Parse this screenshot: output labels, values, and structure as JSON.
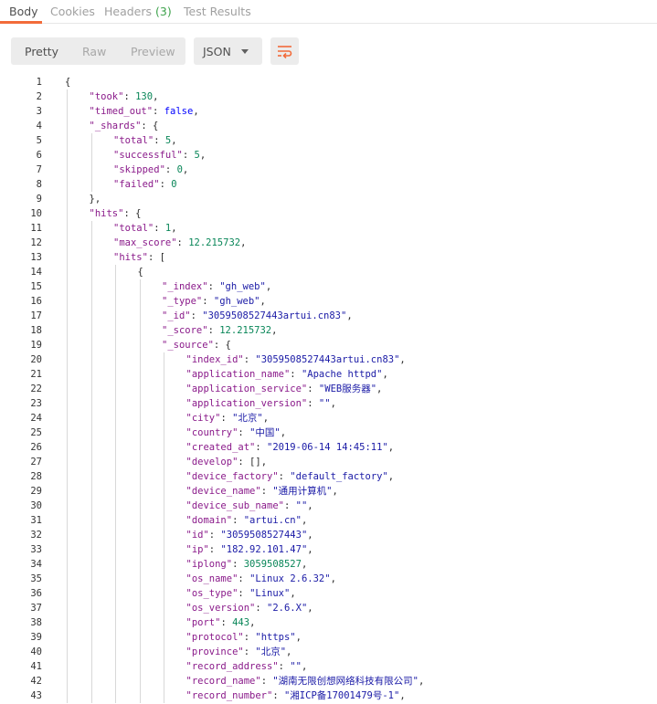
{
  "tabs": [
    {
      "label": "Body",
      "count": "",
      "active": true
    },
    {
      "label": "Cookies",
      "count": "",
      "active": false
    },
    {
      "label": "Headers",
      "count": "(3)",
      "active": false
    },
    {
      "label": "Test Results",
      "count": "",
      "active": false
    }
  ],
  "view_modes": [
    {
      "label": "Pretty",
      "active": true
    },
    {
      "label": "Raw",
      "active": false
    },
    {
      "label": "Preview",
      "active": false
    }
  ],
  "format": {
    "selected": "JSON"
  },
  "icons": {
    "wrap": "wrap-lines-icon",
    "dropdown": "chevron-down-icon"
  },
  "colors": {
    "accent": "#f26b3a",
    "key": "#8a1a8a",
    "string": "#1a1aa6",
    "number": "#098658",
    "boolean": "#0000ff"
  },
  "lines": [
    {
      "n": "1",
      "d": 0,
      "t": [
        [
          "p",
          "{"
        ]
      ]
    },
    {
      "n": "2",
      "d": 1,
      "t": [
        [
          "k",
          "\"took\""
        ],
        [
          "p",
          ": "
        ],
        [
          "n",
          "130"
        ],
        [
          "p",
          ","
        ]
      ]
    },
    {
      "n": "3",
      "d": 1,
      "t": [
        [
          "k",
          "\"timed_out\""
        ],
        [
          "p",
          ": "
        ],
        [
          "b",
          "false"
        ],
        [
          "p",
          ","
        ]
      ]
    },
    {
      "n": "4",
      "d": 1,
      "t": [
        [
          "k",
          "\"_shards\""
        ],
        [
          "p",
          ": {"
        ]
      ]
    },
    {
      "n": "5",
      "d": 2,
      "t": [
        [
          "k",
          "\"total\""
        ],
        [
          "p",
          ": "
        ],
        [
          "n",
          "5"
        ],
        [
          "p",
          ","
        ]
      ]
    },
    {
      "n": "6",
      "d": 2,
      "t": [
        [
          "k",
          "\"successful\""
        ],
        [
          "p",
          ": "
        ],
        [
          "n",
          "5"
        ],
        [
          "p",
          ","
        ]
      ]
    },
    {
      "n": "7",
      "d": 2,
      "t": [
        [
          "k",
          "\"skipped\""
        ],
        [
          "p",
          ": "
        ],
        [
          "n",
          "0"
        ],
        [
          "p",
          ","
        ]
      ]
    },
    {
      "n": "8",
      "d": 2,
      "t": [
        [
          "k",
          "\"failed\""
        ],
        [
          "p",
          ": "
        ],
        [
          "n",
          "0"
        ]
      ]
    },
    {
      "n": "9",
      "d": 1,
      "t": [
        [
          "p",
          "},"
        ]
      ]
    },
    {
      "n": "10",
      "d": 1,
      "t": [
        [
          "k",
          "\"hits\""
        ],
        [
          "p",
          ": {"
        ]
      ]
    },
    {
      "n": "11",
      "d": 2,
      "t": [
        [
          "k",
          "\"total\""
        ],
        [
          "p",
          ": "
        ],
        [
          "n",
          "1"
        ],
        [
          "p",
          ","
        ]
      ]
    },
    {
      "n": "12",
      "d": 2,
      "t": [
        [
          "k",
          "\"max_score\""
        ],
        [
          "p",
          ": "
        ],
        [
          "n",
          "12.215732"
        ],
        [
          "p",
          ","
        ]
      ]
    },
    {
      "n": "13",
      "d": 2,
      "t": [
        [
          "k",
          "\"hits\""
        ],
        [
          "p",
          ": ["
        ]
      ]
    },
    {
      "n": "14",
      "d": 3,
      "t": [
        [
          "p",
          "{"
        ]
      ]
    },
    {
      "n": "15",
      "d": 4,
      "t": [
        [
          "k",
          "\"_index\""
        ],
        [
          "p",
          ": "
        ],
        [
          "s",
          "\"gh_web\""
        ],
        [
          "p",
          ","
        ]
      ]
    },
    {
      "n": "16",
      "d": 4,
      "t": [
        [
          "k",
          "\"_type\""
        ],
        [
          "p",
          ": "
        ],
        [
          "s",
          "\"gh_web\""
        ],
        [
          "p",
          ","
        ]
      ]
    },
    {
      "n": "17",
      "d": 4,
      "t": [
        [
          "k",
          "\"_id\""
        ],
        [
          "p",
          ": "
        ],
        [
          "s",
          "\"3059508527443artui.cn83\""
        ],
        [
          "p",
          ","
        ]
      ]
    },
    {
      "n": "18",
      "d": 4,
      "t": [
        [
          "k",
          "\"_score\""
        ],
        [
          "p",
          ": "
        ],
        [
          "n",
          "12.215732"
        ],
        [
          "p",
          ","
        ]
      ]
    },
    {
      "n": "19",
      "d": 4,
      "t": [
        [
          "k",
          "\"_source\""
        ],
        [
          "p",
          ": {"
        ]
      ]
    },
    {
      "n": "20",
      "d": 5,
      "t": [
        [
          "k",
          "\"index_id\""
        ],
        [
          "p",
          ": "
        ],
        [
          "s",
          "\"3059508527443artui.cn83\""
        ],
        [
          "p",
          ","
        ]
      ]
    },
    {
      "n": "21",
      "d": 5,
      "t": [
        [
          "k",
          "\"application_name\""
        ],
        [
          "p",
          ": "
        ],
        [
          "s",
          "\"Apache httpd\""
        ],
        [
          "p",
          ","
        ]
      ]
    },
    {
      "n": "22",
      "d": 5,
      "t": [
        [
          "k",
          "\"application_service\""
        ],
        [
          "p",
          ": "
        ],
        [
          "s",
          "\"WEB服务器\""
        ],
        [
          "p",
          ","
        ]
      ]
    },
    {
      "n": "23",
      "d": 5,
      "t": [
        [
          "k",
          "\"application_version\""
        ],
        [
          "p",
          ": "
        ],
        [
          "s",
          "\"\""
        ],
        [
          "p",
          ","
        ]
      ]
    },
    {
      "n": "24",
      "d": 5,
      "t": [
        [
          "k",
          "\"city\""
        ],
        [
          "p",
          ": "
        ],
        [
          "s",
          "\"北京\""
        ],
        [
          "p",
          ","
        ]
      ]
    },
    {
      "n": "25",
      "d": 5,
      "t": [
        [
          "k",
          "\"country\""
        ],
        [
          "p",
          ": "
        ],
        [
          "s",
          "\"中国\""
        ],
        [
          "p",
          ","
        ]
      ]
    },
    {
      "n": "26",
      "d": 5,
      "t": [
        [
          "k",
          "\"created_at\""
        ],
        [
          "p",
          ": "
        ],
        [
          "s",
          "\"2019-06-14 14:45:11\""
        ],
        [
          "p",
          ","
        ]
      ]
    },
    {
      "n": "27",
      "d": 5,
      "t": [
        [
          "k",
          "\"develop\""
        ],
        [
          "p",
          ": [],"
        ]
      ]
    },
    {
      "n": "28",
      "d": 5,
      "t": [
        [
          "k",
          "\"device_factory\""
        ],
        [
          "p",
          ": "
        ],
        [
          "s",
          "\"default_factory\""
        ],
        [
          "p",
          ","
        ]
      ]
    },
    {
      "n": "29",
      "d": 5,
      "t": [
        [
          "k",
          "\"device_name\""
        ],
        [
          "p",
          ": "
        ],
        [
          "s",
          "\"通用计算机\""
        ],
        [
          "p",
          ","
        ]
      ]
    },
    {
      "n": "30",
      "d": 5,
      "t": [
        [
          "k",
          "\"device_sub_name\""
        ],
        [
          "p",
          ": "
        ],
        [
          "s",
          "\"\""
        ],
        [
          "p",
          ","
        ]
      ]
    },
    {
      "n": "31",
      "d": 5,
      "t": [
        [
          "k",
          "\"domain\""
        ],
        [
          "p",
          ": "
        ],
        [
          "s",
          "\"artui.cn\""
        ],
        [
          "p",
          ","
        ]
      ]
    },
    {
      "n": "32",
      "d": 5,
      "t": [
        [
          "k",
          "\"id\""
        ],
        [
          "p",
          ": "
        ],
        [
          "s",
          "\"3059508527443\""
        ],
        [
          "p",
          ","
        ]
      ]
    },
    {
      "n": "33",
      "d": 5,
      "t": [
        [
          "k",
          "\"ip\""
        ],
        [
          "p",
          ": "
        ],
        [
          "s",
          "\"182.92.101.47\""
        ],
        [
          "p",
          ","
        ]
      ]
    },
    {
      "n": "34",
      "d": 5,
      "t": [
        [
          "k",
          "\"iplong\""
        ],
        [
          "p",
          ": "
        ],
        [
          "n",
          "3059508527"
        ],
        [
          "p",
          ","
        ]
      ]
    },
    {
      "n": "35",
      "d": 5,
      "t": [
        [
          "k",
          "\"os_name\""
        ],
        [
          "p",
          ": "
        ],
        [
          "s",
          "\"Linux 2.6.32\""
        ],
        [
          "p",
          ","
        ]
      ]
    },
    {
      "n": "36",
      "d": 5,
      "t": [
        [
          "k",
          "\"os_type\""
        ],
        [
          "p",
          ": "
        ],
        [
          "s",
          "\"Linux\""
        ],
        [
          "p",
          ","
        ]
      ]
    },
    {
      "n": "37",
      "d": 5,
      "t": [
        [
          "k",
          "\"os_version\""
        ],
        [
          "p",
          ": "
        ],
        [
          "s",
          "\"2.6.X\""
        ],
        [
          "p",
          ","
        ]
      ]
    },
    {
      "n": "38",
      "d": 5,
      "t": [
        [
          "k",
          "\"port\""
        ],
        [
          "p",
          ": "
        ],
        [
          "n",
          "443"
        ],
        [
          "p",
          ","
        ]
      ]
    },
    {
      "n": "39",
      "d": 5,
      "t": [
        [
          "k",
          "\"protocol\""
        ],
        [
          "p",
          ": "
        ],
        [
          "s",
          "\"https\""
        ],
        [
          "p",
          ","
        ]
      ]
    },
    {
      "n": "40",
      "d": 5,
      "t": [
        [
          "k",
          "\"province\""
        ],
        [
          "p",
          ": "
        ],
        [
          "s",
          "\"北京\""
        ],
        [
          "p",
          ","
        ]
      ]
    },
    {
      "n": "41",
      "d": 5,
      "t": [
        [
          "k",
          "\"record_address\""
        ],
        [
          "p",
          ": "
        ],
        [
          "s",
          "\"\""
        ],
        [
          "p",
          ","
        ]
      ]
    },
    {
      "n": "42",
      "d": 5,
      "t": [
        [
          "k",
          "\"record_name\""
        ],
        [
          "p",
          ": "
        ],
        [
          "s",
          "\"湖南无限创想网络科技有限公司\""
        ],
        [
          "p",
          ","
        ]
      ]
    },
    {
      "n": "43",
      "d": 5,
      "t": [
        [
          "k",
          "\"record_number\""
        ],
        [
          "p",
          ": "
        ],
        [
          "s",
          "\"湘ICP备17001479号-1\""
        ],
        [
          "p",
          ","
        ]
      ]
    }
  ]
}
